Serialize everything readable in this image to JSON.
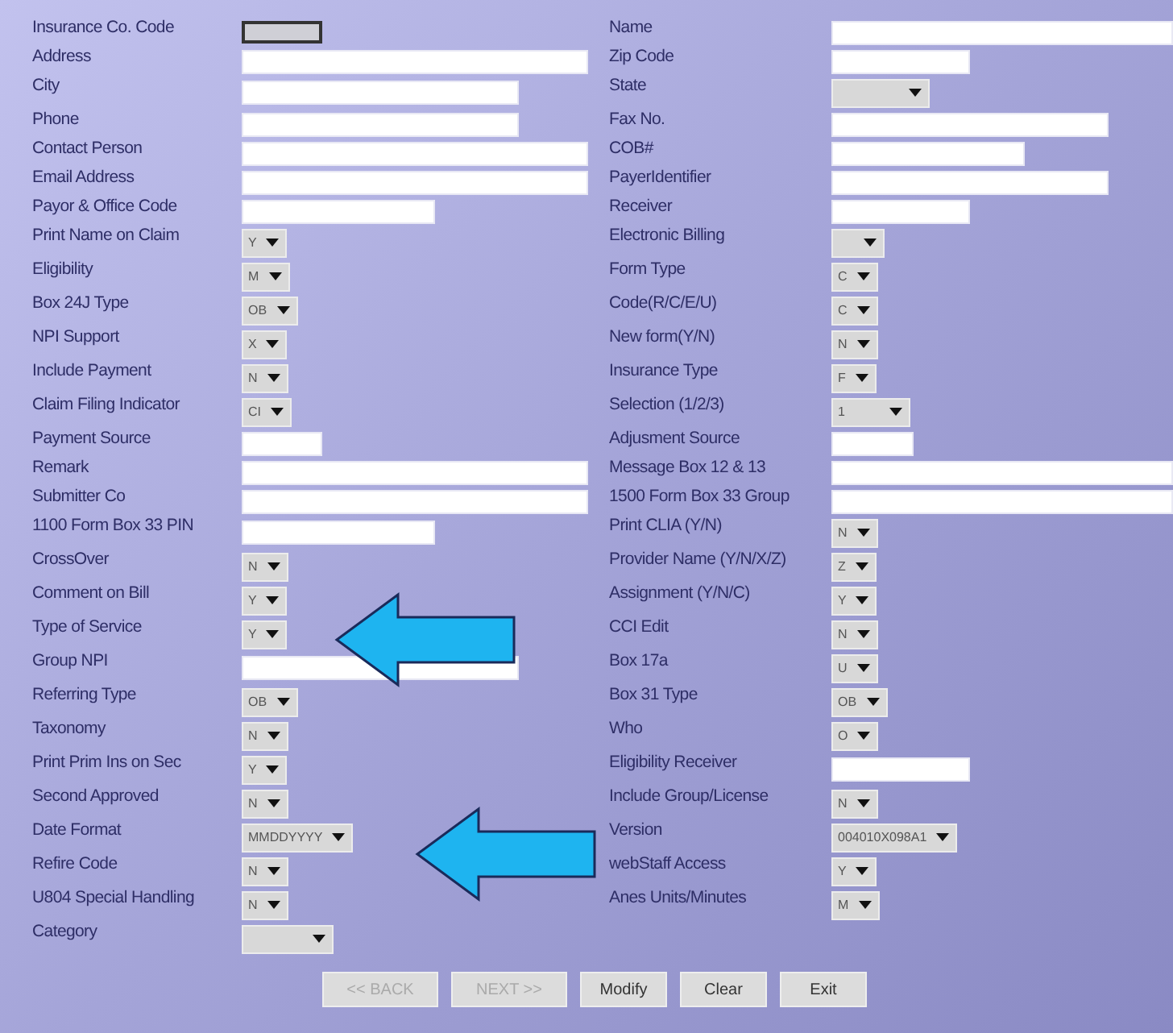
{
  "rows": [
    {
      "left": {
        "label": "Insurance Co. Code",
        "kind": "text",
        "disabled": true
      },
      "right": {
        "label": "Name",
        "kind": "text",
        "disabled": false
      }
    },
    {
      "left": {
        "label": "Address",
        "kind": "text",
        "disabled": false
      },
      "right": {
        "label": "Zip Code",
        "kind": "text",
        "disabled": false
      }
    },
    {
      "left": {
        "label": "City",
        "kind": "text",
        "disabled": false
      },
      "right": {
        "label": "State",
        "kind": "select"
      }
    },
    {
      "left": {
        "label": "Phone",
        "kind": "text",
        "disabled": false
      },
      "right": {
        "label": "Fax No.",
        "kind": "text",
        "disabled": false
      }
    },
    {
      "left": {
        "label": "Contact Person",
        "kind": "text",
        "disabled": false
      },
      "right": {
        "label": "COB#",
        "kind": "text",
        "disabled": false
      }
    },
    {
      "left": {
        "label": "Email Address",
        "kind": "text",
        "disabled": false
      },
      "right": {
        "label": "PayerIdentifier",
        "kind": "text",
        "disabled": false
      }
    },
    {
      "left": {
        "label": "Payor & Office Code",
        "kind": "text",
        "disabled": false
      },
      "right": {
        "label": "Receiver",
        "kind": "text",
        "disabled": false
      }
    },
    {
      "left": {
        "label": "Print Name on Claim",
        "kind": "select",
        "value": "Y"
      },
      "right": {
        "label": "Electronic Billing",
        "kind": "select"
      }
    },
    {
      "left": {
        "label": "Eligibility",
        "kind": "select",
        "value": "M"
      },
      "right": {
        "label": "Form Type",
        "kind": "select",
        "value": "C"
      }
    },
    {
      "left": {
        "label": "Box 24J Type",
        "kind": "select",
        "value": "OB"
      },
      "right": {
        "label": "Code(R/C/E/U)",
        "kind": "select",
        "value": "C"
      }
    },
    {
      "left": {
        "label": "NPI Support",
        "kind": "select",
        "value": "X"
      },
      "right": {
        "label": "New form(Y/N)",
        "kind": "select",
        "value": "N"
      }
    },
    {
      "left": {
        "label": "Include Payment",
        "kind": "select",
        "value": "N"
      },
      "right": {
        "label": "Insurance Type",
        "kind": "select",
        "value": "F"
      }
    },
    {
      "left": {
        "label": "Claim Filing Indicator",
        "kind": "select",
        "value": "CI"
      },
      "right": {
        "label": "Selection (1/2/3)",
        "kind": "select",
        "value": "1"
      }
    },
    {
      "left": {
        "label": "Payment Source",
        "kind": "text",
        "disabled": false
      },
      "right": {
        "label": "Adjusment Source",
        "kind": "text",
        "disabled": false
      }
    },
    {
      "left": {
        "label": "Remark",
        "kind": "text",
        "disabled": false
      },
      "right": {
        "label": "Message Box 12 & 13",
        "kind": "text",
        "disabled": false
      }
    },
    {
      "left": {
        "label": "Submitter Co",
        "kind": "text",
        "disabled": false
      },
      "right": {
        "label": "1500 Form Box 33 Group",
        "kind": "text",
        "disabled": false
      }
    },
    {
      "left": {
        "label": "1100 Form Box 33 PIN",
        "kind": "text",
        "disabled": false
      },
      "right": {
        "label": "Print CLIA (Y/N)",
        "kind": "select",
        "value": "N"
      }
    },
    {
      "left": {
        "label": "CrossOver",
        "kind": "select",
        "value": "N"
      },
      "right": {
        "label": "Provider Name (Y/N/X/Z)",
        "kind": "select",
        "value": "Z"
      }
    },
    {
      "left": {
        "label": "Comment on Bill",
        "kind": "select",
        "value": "Y"
      },
      "right": {
        "label": "Assignment (Y/N/C)",
        "kind": "select",
        "value": "Y"
      }
    },
    {
      "left": {
        "label": "Type of Service",
        "kind": "select",
        "value": "Y"
      },
      "right": {
        "label": "CCI Edit",
        "kind": "select",
        "value": "N"
      }
    },
    {
      "left": {
        "label": "Group NPI",
        "kind": "text",
        "disabled": false
      },
      "right": {
        "label": "Box 17a",
        "kind": "select",
        "value": "U"
      }
    },
    {
      "left": {
        "label": "Referring Type",
        "kind": "select",
        "value": "OB"
      },
      "right": {
        "label": "Box 31 Type",
        "kind": "select",
        "value": "OB"
      }
    },
    {
      "left": {
        "label": "Taxonomy",
        "kind": "select",
        "value": "N"
      },
      "right": {
        "label": "Who",
        "kind": "select",
        "value": "O"
      }
    },
    {
      "left": {
        "label": "Print Prim Ins on Sec",
        "kind": "select",
        "value": "Y"
      },
      "right": {
        "label": "Eligibility Receiver",
        "kind": "text",
        "disabled": false
      }
    },
    {
      "left": {
        "label": "Second Approved",
        "kind": "select",
        "value": "N"
      },
      "right": {
        "label": "Include Group/License",
        "kind": "select",
        "value": "N"
      }
    },
    {
      "left": {
        "label": "Date Format",
        "kind": "select",
        "value": "MMDDYYYY"
      },
      "right": {
        "label": "Version",
        "kind": "select",
        "value": "004010X098A1"
      }
    },
    {
      "left": {
        "label": "Refire Code",
        "kind": "select",
        "value": "N"
      },
      "right": {
        "label": "webStaff Access",
        "kind": "select",
        "value": "Y"
      }
    },
    {
      "left": {
        "label": "U804 Special Handling",
        "kind": "select",
        "value": "N"
      },
      "right": {
        "label": "Anes Units/Minutes",
        "kind": "select",
        "value": "M"
      }
    },
    {
      "left": {
        "label": "Category",
        "kind": "select"
      }
    }
  ],
  "buttons": [
    {
      "label": "<< BACK",
      "disabled": true
    },
    {
      "label": "NEXT >>",
      "disabled": true
    },
    {
      "label": "Modify",
      "disabled": false
    },
    {
      "label": "Clear",
      "disabled": false
    },
    {
      "label": "Exit",
      "disabled": false
    }
  ]
}
